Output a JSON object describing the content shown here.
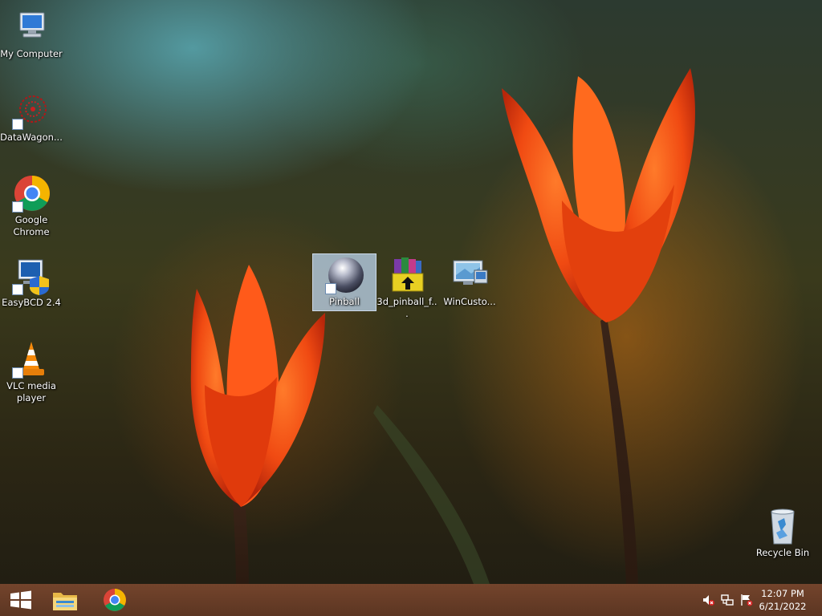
{
  "desktop": {
    "icons": [
      {
        "label": "My Computer"
      },
      {
        "label": "DataWagon..."
      },
      {
        "label": "Google Chrome"
      },
      {
        "label": "EasyBCD 2.4"
      },
      {
        "label": "VLC media player"
      },
      {
        "label": "Pinball"
      },
      {
        "label": "3d_pinball_f..."
      },
      {
        "label": "WinCusto..."
      },
      {
        "label": "Recycle Bin"
      }
    ],
    "selected_icon": "Pinball"
  },
  "taskbar": {
    "start_icon": "windows-logo-icon",
    "pinned": [
      {
        "icon": "file-explorer-icon"
      },
      {
        "icon": "chrome-icon"
      }
    ],
    "tray": [
      {
        "icon": "speaker-muted-icon"
      },
      {
        "icon": "network-icon"
      },
      {
        "icon": "action-center-flag-icon"
      }
    ],
    "clock": {
      "time": "12:07 PM",
      "date": "6/21/2022"
    }
  },
  "colors": {
    "taskbar": "#6e4028",
    "selection": "#bed7f0",
    "tulip": "#f04a12"
  }
}
